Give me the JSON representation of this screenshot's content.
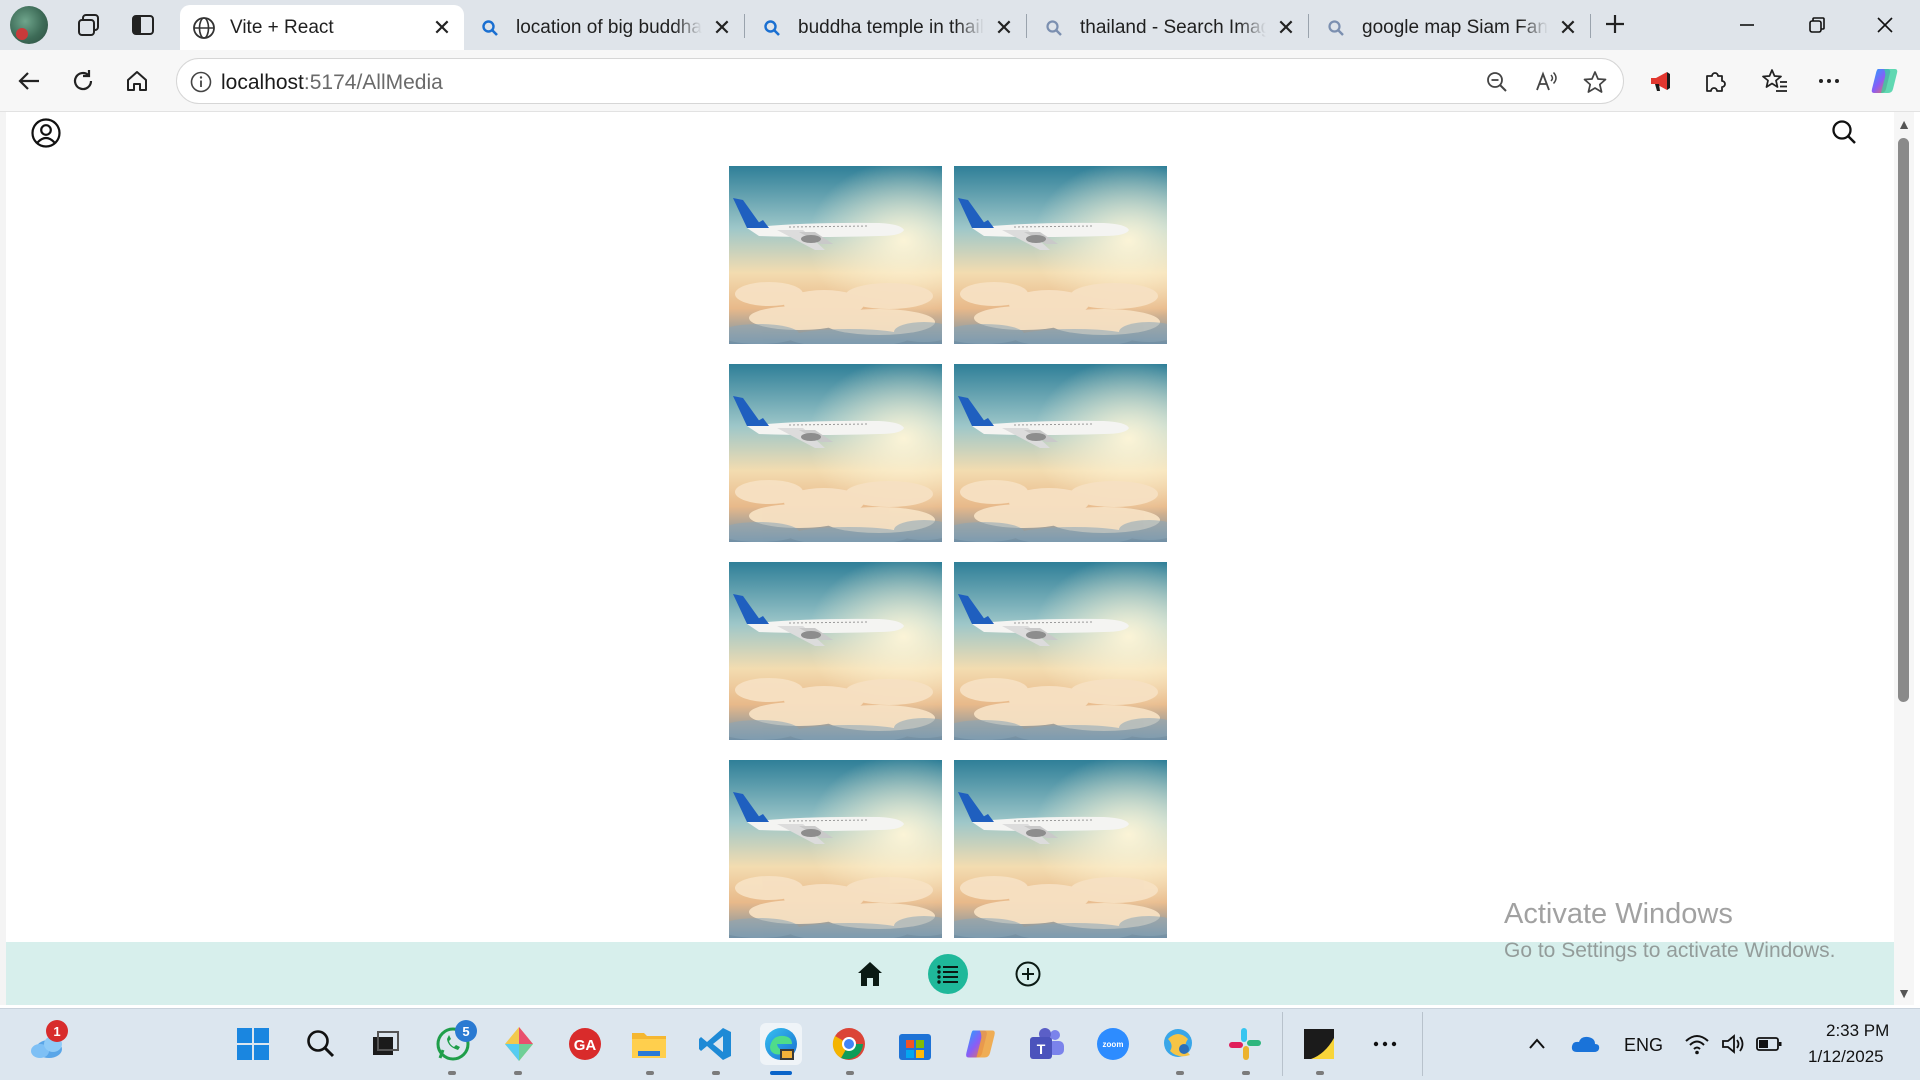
{
  "browser": {
    "tabs": [
      {
        "title": "Vite + React",
        "favicon": "globe-icon",
        "active": true
      },
      {
        "title": "location of big buddha t",
        "favicon": "search-icon",
        "active": false
      },
      {
        "title": "buddha temple in thaila",
        "favicon": "search-icon",
        "active": false
      },
      {
        "title": "thailand - Search Image",
        "favicon": "search-icon",
        "active": false
      },
      {
        "title": "google map Siam Fanta",
        "favicon": "search-icon",
        "active": false
      }
    ],
    "url_host": "localhost",
    "url_rest": ":5174/AllMedia"
  },
  "page": {
    "media_items": [
      {
        "alt": "airplane-above-clouds"
      },
      {
        "alt": "airplane-above-clouds"
      },
      {
        "alt": "airplane-above-clouds"
      },
      {
        "alt": "airplane-above-clouds"
      },
      {
        "alt": "airplane-above-clouds"
      },
      {
        "alt": "airplane-above-clouds"
      },
      {
        "alt": "airplane-above-clouds"
      },
      {
        "alt": "airplane-above-clouds"
      }
    ],
    "bottom_nav": [
      {
        "icon": "home-icon",
        "active": false
      },
      {
        "icon": "list-icon",
        "active": true
      },
      {
        "icon": "add-circle-icon",
        "active": false
      }
    ],
    "accent_color": "#1fb89a",
    "bottom_nav_bg": "#d7efec"
  },
  "watermark": {
    "line1": "Activate Windows",
    "line2": "Go to Settings to activate Windows."
  },
  "taskbar": {
    "weather_badge": "1",
    "whatsapp_badge": "5",
    "language": "ENG",
    "time": "2:33 PM",
    "date": "1/12/2025"
  }
}
